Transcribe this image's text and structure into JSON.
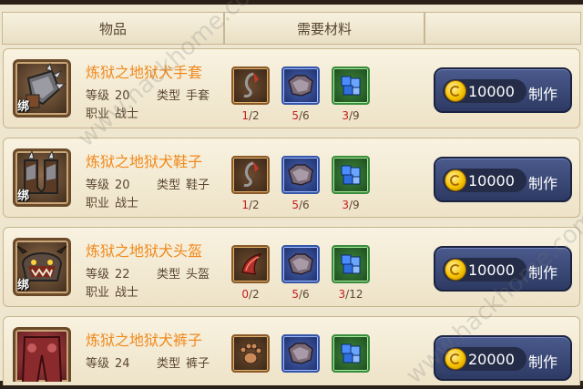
{
  "header": {
    "col_item": "物品",
    "col_materials": "需要材料",
    "col_action": ""
  },
  "rows": [
    {
      "name": "炼狱之地狱犬手套",
      "level_label": "等级",
      "level": "20",
      "type_label": "类型",
      "type": "手套",
      "job_label": "职业",
      "job": "战士",
      "bind": "绑",
      "item_icon": "gauntlet-icon",
      "materials": [
        {
          "icon": "hook-ore-icon",
          "have": "1",
          "need": "2"
        },
        {
          "icon": "beast-hide-icon",
          "have": "5",
          "need": "6"
        },
        {
          "icon": "blue-crystal-icon",
          "have": "3",
          "need": "9"
        }
      ],
      "cost": "10000",
      "craft_label": "制作"
    },
    {
      "name": "炼狱之地狱犬鞋子",
      "level_label": "等级",
      "level": "20",
      "type_label": "类型",
      "type": "鞋子",
      "job_label": "职业",
      "job": "战士",
      "bind": "绑",
      "item_icon": "boots-icon",
      "materials": [
        {
          "icon": "hook-ore-icon",
          "have": "1",
          "need": "2"
        },
        {
          "icon": "beast-hide-icon",
          "have": "5",
          "need": "6"
        },
        {
          "icon": "blue-crystal-icon",
          "have": "3",
          "need": "9"
        }
      ],
      "cost": "10000",
      "craft_label": "制作"
    },
    {
      "name": "炼狱之地狱犬头盔",
      "level_label": "等级",
      "level": "22",
      "type_label": "类型",
      "type": "头盔",
      "job_label": "职业",
      "job": "战士",
      "bind": "绑",
      "item_icon": "helmet-icon",
      "materials": [
        {
          "icon": "red-horn-icon",
          "have": "0",
          "need": "2"
        },
        {
          "icon": "beast-hide-icon",
          "have": "5",
          "need": "6"
        },
        {
          "icon": "blue-crystal-icon",
          "have": "3",
          "need": "12"
        }
      ],
      "cost": "10000",
      "craft_label": "制作"
    },
    {
      "name": "炼狱之地狱犬裤子",
      "level_label": "等级",
      "level": "24",
      "type_label": "类型",
      "type": "裤子",
      "job_label": "职业",
      "job": "",
      "bind": "",
      "item_icon": "pants-icon",
      "materials": [
        {
          "icon": "paw-print-icon",
          "have": "",
          "need": ""
        },
        {
          "icon": "beast-hide-icon",
          "have": "",
          "need": ""
        },
        {
          "icon": "blue-crystal-icon",
          "have": "",
          "need": ""
        }
      ],
      "cost": "20000",
      "craft_label": "制作"
    }
  ],
  "watermark": "www.hackhome.com",
  "colors": {
    "item_name": "#f08a1e",
    "qty_have": "#c81c1c",
    "button": "#2d3a63",
    "coin": "#f5c300"
  }
}
